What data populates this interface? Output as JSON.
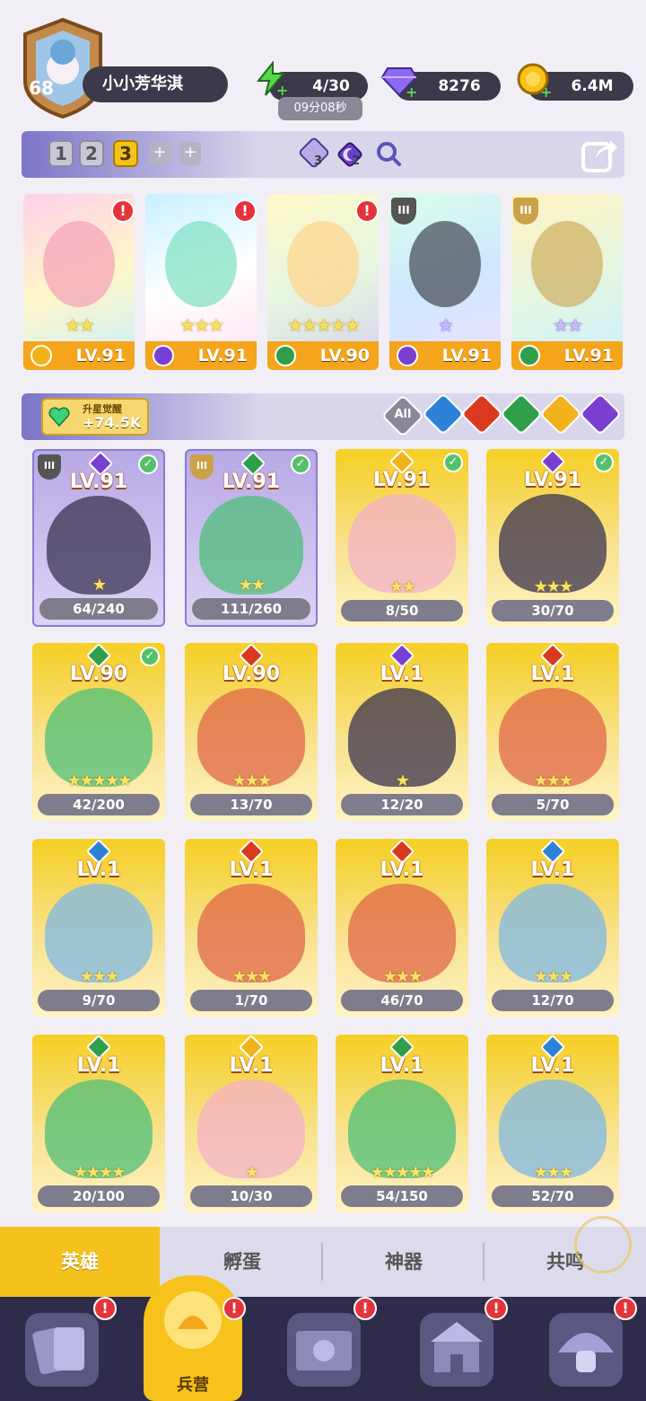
{
  "player": {
    "level": "68",
    "name": "小小芳华淇"
  },
  "resources": {
    "energy": "4/30",
    "energy_timer": "09分08秒",
    "gems": "8276",
    "gold": "6.4M"
  },
  "teams": {
    "tabs": [
      "1",
      "2",
      "3"
    ],
    "active": "3",
    "plus": [
      "+",
      "+"
    ],
    "pet_count_a": "3",
    "pet_count_b": "2"
  },
  "team_cards": [
    {
      "level": "LV.91",
      "stars": "★★",
      "element": "light",
      "alert": "!"
    },
    {
      "level": "LV.91",
      "stars": "★★★",
      "element": "dark",
      "alert": "!"
    },
    {
      "level": "LV.90",
      "stars": "★★★★★",
      "element": "nature",
      "alert": "!"
    },
    {
      "level": "LV.91",
      "stars": "★",
      "element": "dark",
      "rank": "III"
    },
    {
      "level": "LV.91",
      "stars": "★★",
      "element": "nature",
      "rank": "III"
    }
  ],
  "awaken": {
    "label": "升星觉醒",
    "value": "+74.5K"
  },
  "filters": [
    "All",
    "water",
    "fire",
    "nature",
    "light",
    "dark"
  ],
  "heroes": [
    {
      "level": "LV.91",
      "count": "64/240",
      "element": "dark",
      "stars": "★",
      "rank": "III",
      "check": true,
      "selected": true
    },
    {
      "level": "LV.91",
      "count": "111/260",
      "element": "nature",
      "stars": "★★",
      "rank": "III",
      "check": true,
      "selected": true
    },
    {
      "level": "LV.91",
      "count": "8/50",
      "element": "light",
      "stars": "★★",
      "check": true
    },
    {
      "level": "LV.91",
      "count": "30/70",
      "element": "dark",
      "stars": "★★★",
      "check": true
    },
    {
      "level": "LV.90",
      "count": "42/200",
      "element": "nature",
      "stars": "★★★★★",
      "check": true
    },
    {
      "level": "LV.90",
      "count": "13/70",
      "element": "fire",
      "stars": "★★★"
    },
    {
      "level": "LV.1",
      "count": "12/20",
      "element": "dark",
      "stars": "★"
    },
    {
      "level": "LV.1",
      "count": "5/70",
      "element": "fire",
      "stars": "★★★"
    },
    {
      "level": "LV.1",
      "count": "9/70",
      "element": "water",
      "stars": "★★★"
    },
    {
      "level": "LV.1",
      "count": "1/70",
      "element": "fire",
      "stars": "★★★"
    },
    {
      "level": "LV.1",
      "count": "46/70",
      "element": "fire",
      "stars": "★★★"
    },
    {
      "level": "LV.1",
      "count": "12/70",
      "element": "water",
      "stars": "★★★"
    },
    {
      "level": "LV.1",
      "count": "20/100",
      "element": "nature",
      "stars": "★★★★"
    },
    {
      "level": "LV.1",
      "count": "10/30",
      "element": "light",
      "stars": "★"
    },
    {
      "level": "LV.1",
      "count": "54/150",
      "element": "nature",
      "stars": "★★★★★"
    },
    {
      "level": "LV.1",
      "count": "52/70",
      "element": "water",
      "stars": "★★★"
    }
  ],
  "tabs": [
    {
      "label": "英雄",
      "active": true
    },
    {
      "label": "孵蛋"
    },
    {
      "label": "神器"
    },
    {
      "label": "共鸣"
    }
  ],
  "nav": [
    {
      "icon": "cards-icon",
      "alert": "!"
    },
    {
      "icon": "barracks-icon",
      "label": "兵营",
      "alert": "!",
      "active": true
    },
    {
      "icon": "map-icon",
      "alert": "!"
    },
    {
      "icon": "castle-icon",
      "alert": "!"
    },
    {
      "icon": "mushroom-icon",
      "alert": "!"
    }
  ],
  "colors": {
    "light": "#f2b21c",
    "dark": "#7a3fd1",
    "nature": "#2f9f4a",
    "fire": "#d93a1f",
    "water": "#2d82d8"
  }
}
